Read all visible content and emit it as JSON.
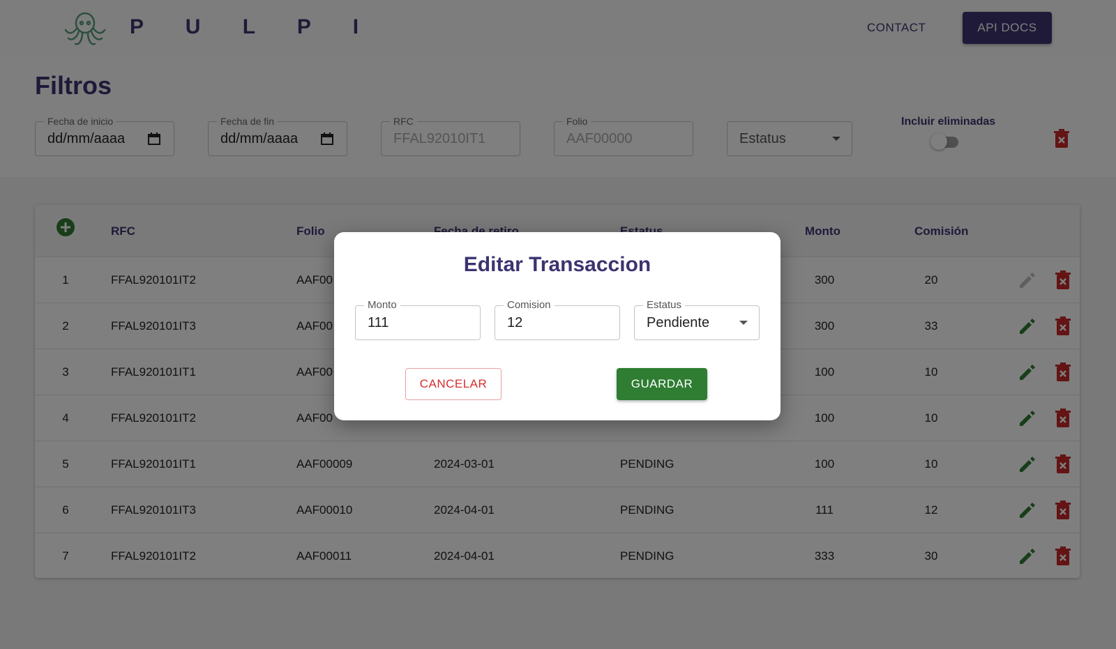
{
  "header": {
    "brand": "P U L P I",
    "contact_label": "CONTACT",
    "api_docs_label": "API DOCS"
  },
  "filters": {
    "title": "Filtros",
    "start_date": {
      "label": "Fecha de inicio",
      "value": "dd/mm/aaaa"
    },
    "end_date": {
      "label": "Fecha de fin",
      "value": "dd/mm/aaaa"
    },
    "rfc": {
      "label": "RFC",
      "placeholder": "FFAL92010IT1"
    },
    "folio": {
      "label": "Folio",
      "placeholder": "AAF00000"
    },
    "status": {
      "value": "Estatus"
    },
    "include_deleted_label": "Incluir eliminadas",
    "include_deleted_on": false
  },
  "table": {
    "columns": [
      "RFC",
      "Folio",
      "Fecha de retiro",
      "Estatus",
      "Monto",
      "Comisión"
    ],
    "rows": [
      {
        "n": "1",
        "rfc": "FFAL920101IT2",
        "folio": "AAF00",
        "fecha": "",
        "estatus": "",
        "monto": "300",
        "comision": "20",
        "edit_disabled": true
      },
      {
        "n": "2",
        "rfc": "FFAL920101IT3",
        "folio": "AAF00",
        "fecha": "",
        "estatus": "",
        "monto": "300",
        "comision": "33",
        "edit_disabled": false
      },
      {
        "n": "3",
        "rfc": "FFAL920101IT1",
        "folio": "AAF00",
        "fecha": "",
        "estatus": "",
        "monto": "100",
        "comision": "10",
        "edit_disabled": false
      },
      {
        "n": "4",
        "rfc": "FFAL920101IT2",
        "folio": "AAF00",
        "fecha": "",
        "estatus": "",
        "monto": "100",
        "comision": "10",
        "edit_disabled": false
      },
      {
        "n": "5",
        "rfc": "FFAL920101IT1",
        "folio": "AAF00009",
        "fecha": "2024-03-01",
        "estatus": "PENDING",
        "monto": "100",
        "comision": "10",
        "edit_disabled": false
      },
      {
        "n": "6",
        "rfc": "FFAL920101IT3",
        "folio": "AAF00010",
        "fecha": "2024-04-01",
        "estatus": "PENDING",
        "monto": "111",
        "comision": "12",
        "edit_disabled": false
      },
      {
        "n": "7",
        "rfc": "FFAL920101IT2",
        "folio": "AAF00011",
        "fecha": "2024-04-01",
        "estatus": "PENDING",
        "monto": "333",
        "comision": "30",
        "edit_disabled": false
      }
    ]
  },
  "dialog": {
    "title": "Editar Transaccion",
    "monto": {
      "label": "Monto",
      "value": "111"
    },
    "comision": {
      "label": "Comision",
      "value": "12"
    },
    "estatus": {
      "label": "Estatus",
      "value": "Pendiente"
    },
    "cancel_label": "CANCELAR",
    "save_label": "GUARDAR"
  },
  "colors": {
    "brand": "#3c3470",
    "success": "#2e7d32",
    "danger": "#d32f2f",
    "overlay": "rgba(0,0,0,0.5)"
  },
  "icons": [
    "octopus-logo-icon",
    "calendar-icon",
    "dropdown-caret-icon",
    "trash-icon",
    "add-circle-icon",
    "pencil-icon"
  ]
}
